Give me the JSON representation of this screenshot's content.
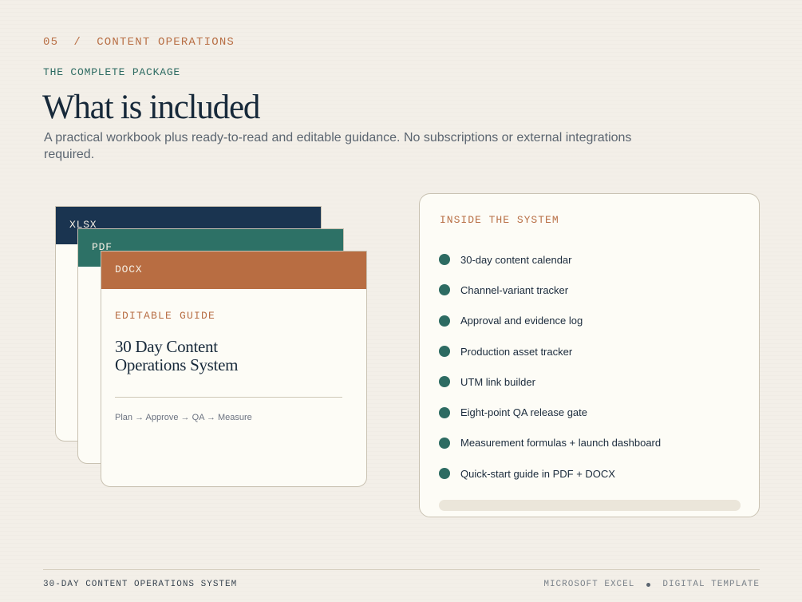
{
  "header": {
    "kicker": "05  /  CONTENT OPERATIONS",
    "eyebrow": "THE COMPLETE PACKAGE",
    "title": "What is included",
    "subtitle": "A practical workbook plus ready-to-read and editable guidance. No subscriptions or external integrations required."
  },
  "documents": {
    "xlsx": "XLSX",
    "pdf": "PDF",
    "docx": "DOCX",
    "docx_label": "EDITABLE GUIDE",
    "docx_title": "30 Day Content Operations System",
    "docx_flow": "Plan → Approve → QA → Measure"
  },
  "panel": {
    "title": "INSIDE THE SYSTEM",
    "items": [
      "30-day content calendar",
      "Channel-variant tracker",
      "Approval and evidence log",
      "Production asset tracker",
      "UTM link builder",
      "Eight-point QA release gate",
      "Measurement formulas + launch dashboard",
      "Quick-start guide in PDF + DOCX"
    ]
  },
  "footer": {
    "left": "30-DAY CONTENT OPERATIONS SYSTEM",
    "right_1": "MICROSOFT EXCEL",
    "right_2": "DIGITAL TEMPLATE"
  },
  "colors": {
    "background": "#f3efe8",
    "navy": "#1a3450",
    "teal": "#2d7166",
    "copper": "#b86d42",
    "card": "#fdfcf6"
  }
}
